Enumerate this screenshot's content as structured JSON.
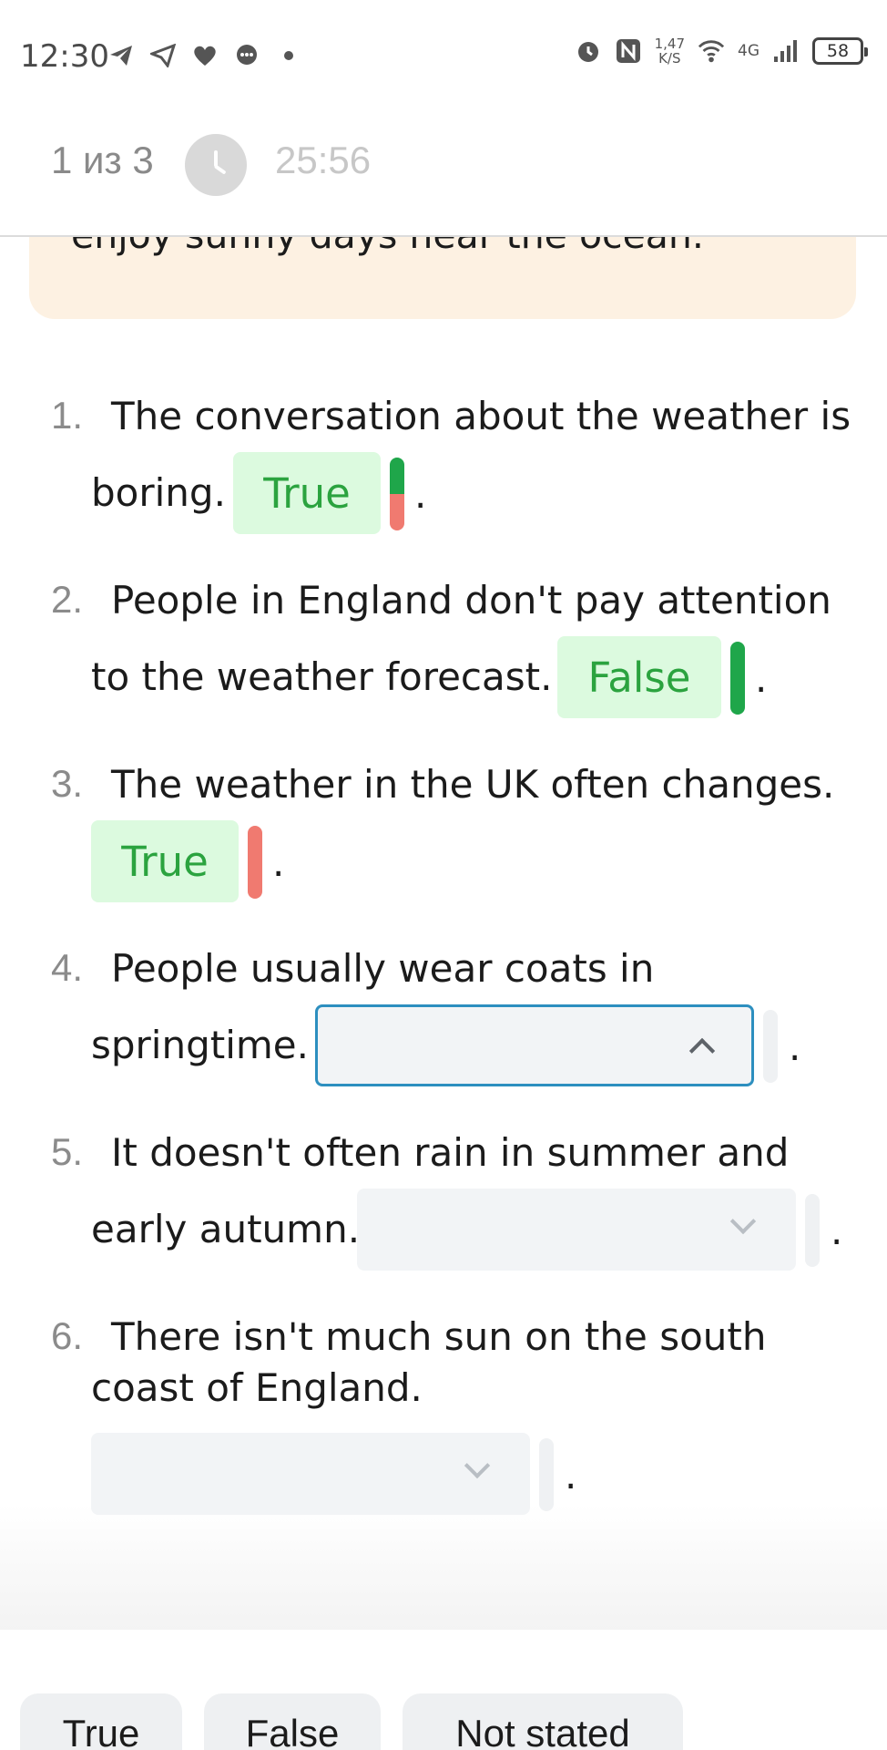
{
  "status_bar": {
    "time": "12:30",
    "left_icons": [
      "telegram-icon",
      "send-icon",
      "heart-icon",
      "chat-icon",
      "dot-icon"
    ],
    "speed_value": "1,47",
    "speed_unit": "K/S",
    "network": "4G",
    "battery": "58"
  },
  "header": {
    "progress": "1 из 3",
    "timer": "25:56"
  },
  "text_card": {
    "visible_line": "enjoy sunny days near the ocean."
  },
  "questions": [
    {
      "number": "1.",
      "lines": [
        "The conversation about the weather is",
        "boring."
      ],
      "answer": "True",
      "mark": "mixed"
    },
    {
      "number": "2.",
      "lines": [
        "People in England don't pay attention",
        "to the weather forecast."
      ],
      "answer": "False",
      "mark": "correct"
    },
    {
      "number": "3.",
      "lines": [
        "The weather in the UK often changes."
      ],
      "answer": "True",
      "mark": "wrong"
    },
    {
      "number": "4.",
      "lines": [
        "People usually wear coats in",
        "springtime."
      ],
      "answer": "",
      "state": "open"
    },
    {
      "number": "5.",
      "lines": [
        "It doesn't often rain in summer and",
        "early autumn."
      ],
      "answer": "",
      "state": "closed"
    },
    {
      "number": "6.",
      "lines": [
        "There isn't much sun on the south",
        "coast of England."
      ],
      "answer": "",
      "state": "closed"
    }
  ],
  "punctuation": ".",
  "options": [
    "True",
    "False",
    "Not stated"
  ],
  "colors": {
    "answer_bg": "#dcfadf",
    "answer_text": "#2ba33f",
    "mark_correct": "#1fa64a",
    "mark_wrong": "#f07a70",
    "select_border_active": "#2d8fbf",
    "card_bg": "#fdf1e2"
  }
}
